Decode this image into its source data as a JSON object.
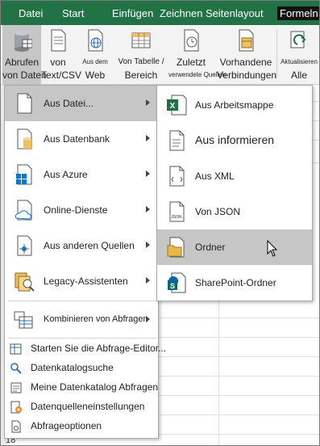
{
  "ribbon_tabs": [
    "Datei",
    "Start",
    "Einfügen",
    "Zeichnen",
    "Seitenlayout",
    "Formeln"
  ],
  "ribbon_buttons": {
    "abrufen_l1": "Abrufen",
    "abrufen_l2": "von Daten",
    "text_l1": "von",
    "text_l2": "Text/CSV",
    "web_l1": "Aus dem",
    "web_l2": "Web",
    "table_l1": "Von Tabelle /",
    "table_l2": "Bereich",
    "recent_l1": "Zuletzt",
    "recent_l2": "verwendete Quellen",
    "conn_l1": "Vorhandene",
    "conn_l2": "Verbindungen",
    "refresh_l1": "Aktualisieren",
    "refresh_l2": "Alle"
  },
  "menu": {
    "items": [
      {
        "label": "Aus Datei...",
        "icon": "file-icon",
        "submenu": true
      },
      {
        "label": "Aus Datenbank",
        "icon": "database-icon",
        "submenu": true
      },
      {
        "label": "Aus Azure",
        "icon": "azure-icon",
        "submenu": true
      },
      {
        "label": "Online-Dienste",
        "icon": "cloud-icon",
        "submenu": true
      },
      {
        "label": "Aus anderen Quellen",
        "icon": "network-icon",
        "submenu": true
      },
      {
        "label": "Legacy-Assistenten",
        "icon": "legacy-icon",
        "submenu": true
      },
      {
        "label": "Kombinieren von Abfragen",
        "icon": "combine-icon",
        "submenu": true
      }
    ],
    "small_items": [
      {
        "label": "Starten Sie die Abfrage-Editor...",
        "icon": "query-editor-icon"
      },
      {
        "label": "Datenkatalogsuche",
        "icon": "catalog-search-icon"
      },
      {
        "label": "Meine Datenkatalog Abfragen",
        "icon": "catalog-queries-icon"
      },
      {
        "label": "Datenquelleneinstellungen",
        "icon": "data-source-settings-icon"
      },
      {
        "label": "Abfrageoptionen",
        "icon": "query-options-icon"
      }
    ]
  },
  "submenu": {
    "items": [
      {
        "label": "Aus Arbeitsmappe",
        "icon": "excel-workbook-icon"
      },
      {
        "label": "Aus informieren",
        "icon": "text-file-icon"
      },
      {
        "label": "Aus XML",
        "icon": "xml-file-icon"
      },
      {
        "label": "Von JSON",
        "icon": "json-file-icon"
      },
      {
        "label": "Ordner",
        "icon": "folder-icon"
      },
      {
        "label": "SharePoint-Ordner",
        "icon": "sharepoint-folder-icon"
      }
    ],
    "json_badge": "JSON"
  },
  "row_header": "18",
  "colors": {
    "ribbon_green": "#217346",
    "highlight": "#c6c6c6",
    "excel_green": "#1e7145",
    "sharepoint_blue": "#0364b8",
    "folder_yellow": "#e8b84a"
  }
}
